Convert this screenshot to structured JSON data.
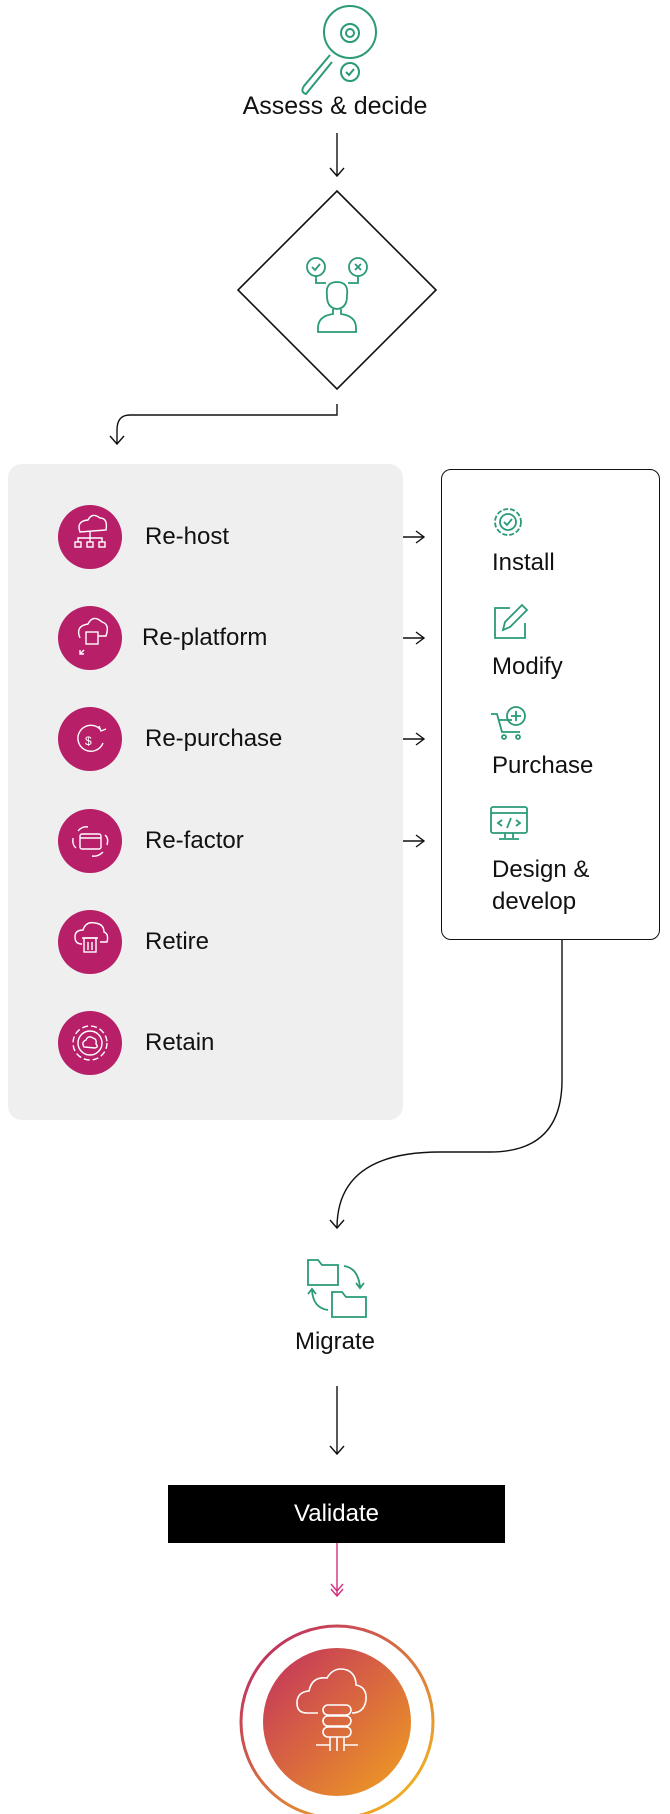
{
  "steps": {
    "assess": {
      "label": "Assess & decide",
      "icon": "magnifier-gear-check-icon"
    },
    "decision": {
      "icon": "person-choice-icon"
    },
    "migrate": {
      "label": "Migrate",
      "icon": "folders-sync-icon"
    },
    "validate": {
      "label": "Validate"
    },
    "final": {
      "icon": "cloud-server-icon"
    }
  },
  "strategies": [
    {
      "label": "Re-host",
      "icon": "cloud-network-icon"
    },
    {
      "label": "Re-platform",
      "icon": "cloud-transfer-icon"
    },
    {
      "label": "Re-purchase",
      "icon": "dollar-refresh-icon"
    },
    {
      "label": "Re-factor",
      "icon": "window-refresh-icon"
    },
    {
      "label": "Retire",
      "icon": "cloud-trash-icon"
    },
    {
      "label": "Retain",
      "icon": "gear-cloud-icon"
    }
  ],
  "actions": [
    {
      "label": "Install",
      "icon": "gear-check-icon"
    },
    {
      "label": "Modify",
      "icon": "edit-pencil-icon"
    },
    {
      "label": "Purchase",
      "icon": "cart-plus-icon"
    },
    {
      "label": "Design &",
      "label2": "develop",
      "icon": "monitor-code-icon"
    }
  ],
  "colors": {
    "green": "#2a9a78",
    "magenta": "#b81f69",
    "panel": "#efefef",
    "gradient_start": "#c0255f",
    "gradient_end": "#f0a020"
  }
}
